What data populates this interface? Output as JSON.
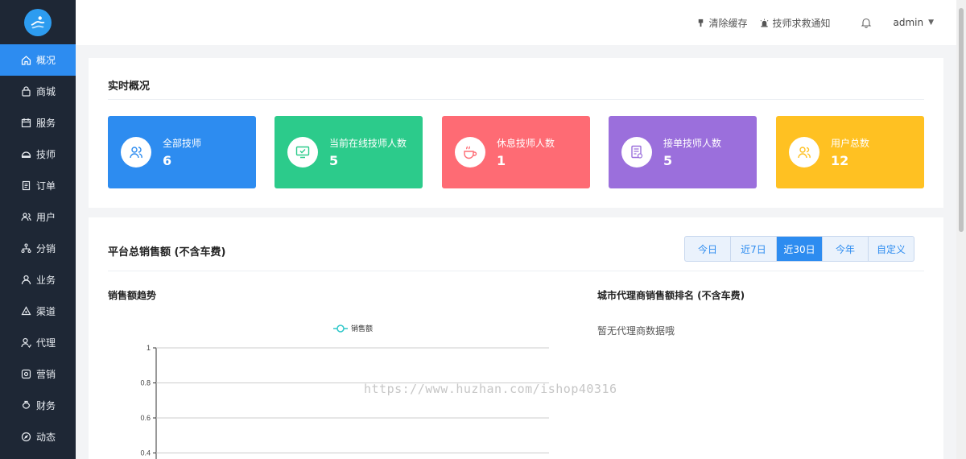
{
  "sidebar": {
    "logo_icon": "brand-logo",
    "items": [
      {
        "label": "概况",
        "icon": "home-icon",
        "active": true
      },
      {
        "label": "商城",
        "icon": "lock-bag-icon"
      },
      {
        "label": "服务",
        "icon": "calendar-icon"
      },
      {
        "label": "技师",
        "icon": "helmet-icon"
      },
      {
        "label": "订单",
        "icon": "document-icon"
      },
      {
        "label": "用户",
        "icon": "users-icon"
      },
      {
        "label": "分销",
        "icon": "network-icon"
      },
      {
        "label": "业务",
        "icon": "person-icon"
      },
      {
        "label": "渠道",
        "icon": "channel-icon"
      },
      {
        "label": "代理",
        "icon": "agent-icon"
      },
      {
        "label": "营销",
        "icon": "marketing-icon"
      },
      {
        "label": "财务",
        "icon": "money-bag-icon"
      },
      {
        "label": "动态",
        "icon": "compass-icon"
      }
    ],
    "accent": "#2d8cf0",
    "bg": "#1e2735"
  },
  "header": {
    "clear_cache": "清除缓存",
    "rescue_notice": "技师求救通知",
    "user": "admin"
  },
  "overview": {
    "title": "实时概况",
    "stats": [
      {
        "label": "全部技师",
        "value": "6",
        "color": "#2d8cf0",
        "icon": "users-icon"
      },
      {
        "label": "当前在线技师人数",
        "value": "5",
        "color": "#2ccb8b",
        "icon": "monitor-check-icon"
      },
      {
        "label": "休息技师人数",
        "value": "1",
        "color": "#fe6b74",
        "icon": "coffee-icon"
      },
      {
        "label": "接单技师人数",
        "value": "5",
        "color": "#9b6fdc",
        "icon": "order-doc-icon"
      },
      {
        "label": "用户总数",
        "value": "12",
        "color": "#ffc122",
        "icon": "user-group-icon"
      }
    ]
  },
  "sales": {
    "title": "平台总销售额 (不含车费)",
    "tabs": [
      "今日",
      "近7日",
      "近30日",
      "今年",
      "自定义"
    ],
    "active_tab": 2,
    "trend_title": "销售额趋势",
    "ranking_title": "城市代理商销售额排名 (不含车费)",
    "ranking_empty": "暂无代理商数据哦"
  },
  "chart_data": {
    "type": "line",
    "series": [
      {
        "name": "销售额",
        "values": []
      }
    ],
    "yticks": [
      "1",
      "0.8",
      "0.6",
      "0.4"
    ],
    "ylim": [
      0,
      1
    ],
    "grid": true,
    "legend": "top-center"
  },
  "watermark": "https://www.huzhan.com/ishop40316"
}
